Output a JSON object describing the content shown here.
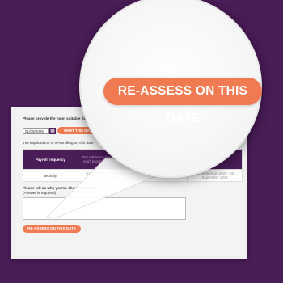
{
  "form": {
    "date_prompt": "Please provide the most suitable date:",
    "date_value": "01/09/2025",
    "what_button_label": "WHAT THIS DATE MEANS",
    "implications_heading": "The implications of re-enrolling on this date",
    "table": {
      "headers": [
        "Payroll frequency",
        "Pay reference period in which you'll process earnings date",
        "",
        ""
      ],
      "row": [
        "Monthly",
        "01 September 2025 - 30 September 2025",
        "",
        "01 September 2025 - 30 September 2025"
      ]
    },
    "reason_prompt": "Please tell us why you've chosen this date",
    "reason_required": "(Answer is required)",
    "reassess_button_label": "RE-ASSESS ON THIS DATE"
  },
  "magnifier": {
    "button_label": "RE-ASSESS ON THIS DATE"
  },
  "colors": {
    "background": "#4a1c58",
    "accent": "#f07a52",
    "table_header": "#4a1c58"
  },
  "icons": {
    "calendar": "calendar-icon"
  }
}
